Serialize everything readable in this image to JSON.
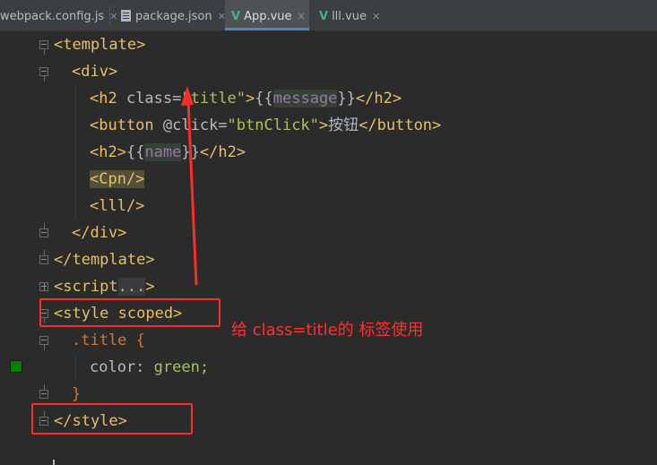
{
  "tabs": [
    {
      "label": "webpack.config.js",
      "active": false
    },
    {
      "label": "package.json",
      "active": false
    },
    {
      "label": "App.vue",
      "active": true
    },
    {
      "label": "lll.vue",
      "active": false
    }
  ],
  "code": {
    "l1": {
      "open": "<template>"
    },
    "l2": {
      "open": "<div>"
    },
    "l3": {
      "tag_open": "<h2 ",
      "attr": "class=",
      "str": "\"title\"",
      "gt": ">",
      "mus_open": "{{",
      "var": "message",
      "mus_close": "}}",
      "close": "</h2>"
    },
    "l4": {
      "tag_open": "<button ",
      "attr": "@click=",
      "str": "\"btnClick\"",
      "gt": ">",
      "text": "按钮",
      "close": "</button>"
    },
    "l5": {
      "tag_open": "<h2>",
      "mus_open": "{{",
      "var": "name",
      "mus_close": "}}",
      "close": "</h2>"
    },
    "l6": {
      "tag": "<Cpn/>"
    },
    "l7": {
      "tag": "<lll/>"
    },
    "l8": {
      "tag": "</div>"
    },
    "l9": {
      "tag": "</template>"
    },
    "l10": {
      "tag_open": "<script",
      "dots": "...",
      "gt": ">"
    },
    "l11": {
      "tag": "<style scoped>"
    },
    "l12": {
      "selector": ".title {"
    },
    "l13": {
      "prop": "color: ",
      "value": "green;"
    },
    "l14": {
      "brace": "}"
    },
    "l15": {
      "tag": "</style>"
    }
  },
  "annotation": "给 class=title的 标签使用",
  "colors": {
    "accent_red": "#ff2a2a",
    "swatch_green": "#008000"
  }
}
